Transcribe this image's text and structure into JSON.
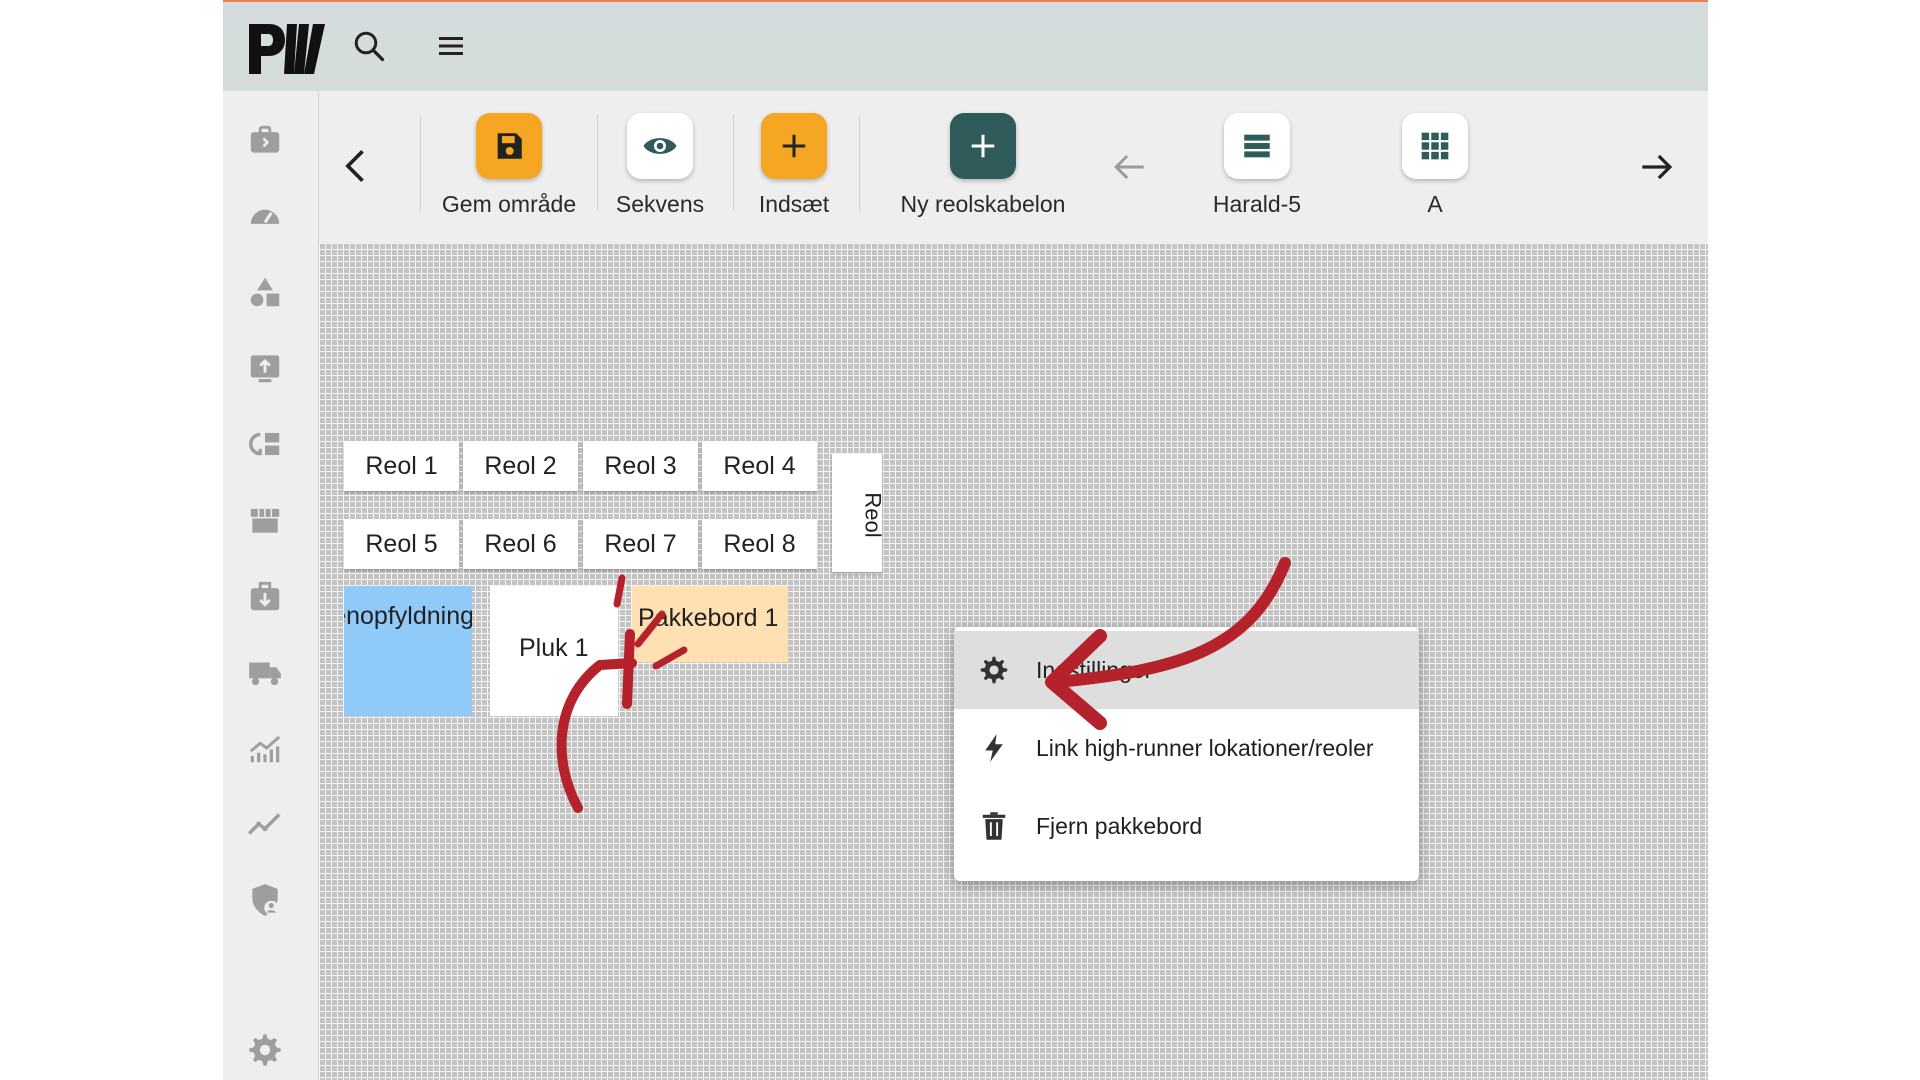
{
  "colors": {
    "accent": "#f5a623",
    "teal": "#2f5b5b",
    "annotation": "#b5222b",
    "zone_blue": "#90caf9",
    "zone_orange": "#ffe0b2"
  },
  "topbar": {
    "logo": "PW",
    "icons": [
      "search-icon",
      "menu-icon"
    ]
  },
  "sidebar": {
    "icons": [
      "briefcase-icon",
      "speedometer-icon",
      "shapes-icon",
      "upload-icon",
      "layout-icon",
      "store-icon",
      "download-icon",
      "truck-icon",
      "bar-chart-icon",
      "trend-icon",
      "shield-user-icon",
      "settings-icon"
    ]
  },
  "toolbar": {
    "save_label": "Gem område",
    "sequence_label": "Sekvens",
    "insert_label": "Indsæt",
    "new_template_label": "Ny reolskabelon",
    "harald_label": "Harald-5",
    "a_label": "A"
  },
  "canvas": {
    "shelves": [
      "Reol 1",
      "Reol 2",
      "Reol 3",
      "Reol 4",
      "Reol 5",
      "Reol 6",
      "Reol 7",
      "Reol 8"
    ],
    "vertical_shelf": "Reol",
    "zones": {
      "refill": "Genopfyldning",
      "pick": "Pluk 1",
      "pack": "Pakkebord 1"
    }
  },
  "context_menu": {
    "settings": "Indstillinger",
    "link": "Link high-runner lokationer/reoler",
    "remove": "Fjern pakkebord"
  }
}
